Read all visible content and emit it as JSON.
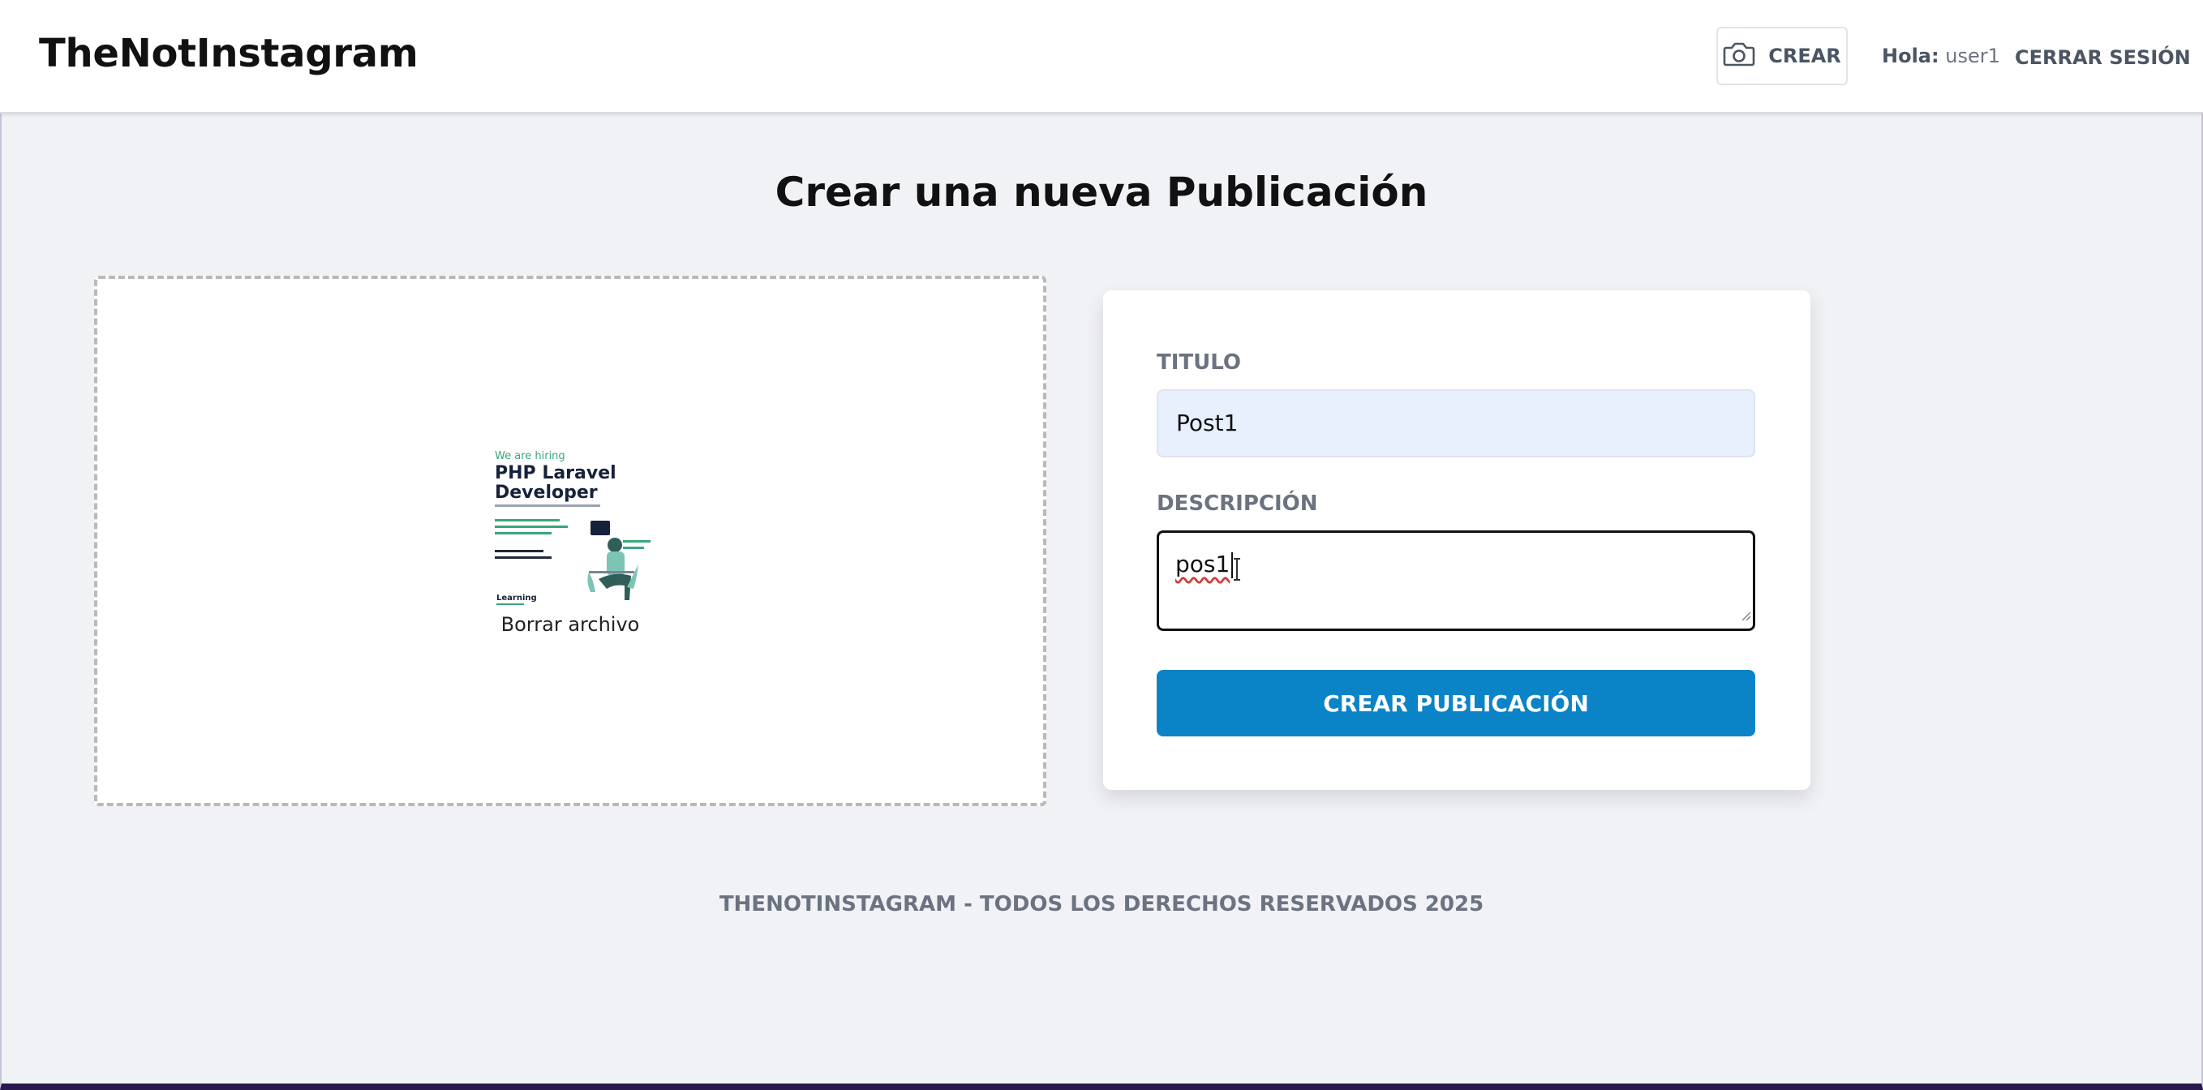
{
  "header": {
    "logo": "TheNotInstagram",
    "create_label": "CREAR",
    "greeting_label": "Hola:",
    "username": "user1",
    "logout_label": "CERRAR SESIÓN"
  },
  "main": {
    "title": "Crear una nueva Publicación",
    "dropzone": {
      "remove_file_label": "Borrar archivo",
      "preview": {
        "tagline": "We are hiring",
        "heading_line1": "PHP Laravel",
        "heading_line2": "Developer",
        "brand": "Learning"
      }
    },
    "form": {
      "title_label": "TITULO",
      "title_value": "Post1",
      "description_label": "DESCRIPCIÓN",
      "description_value": "pos1",
      "submit_label": "CREAR PUBLICACIÓN"
    }
  },
  "footer": {
    "text": "THENOTINSTAGRAM - TODOS LOS DERECHOS RESERVADOS 2025"
  },
  "colors": {
    "primary_button": "#0a84c6",
    "page_background": "#f1f2f6",
    "title_input_background": "#e8f0fe"
  }
}
